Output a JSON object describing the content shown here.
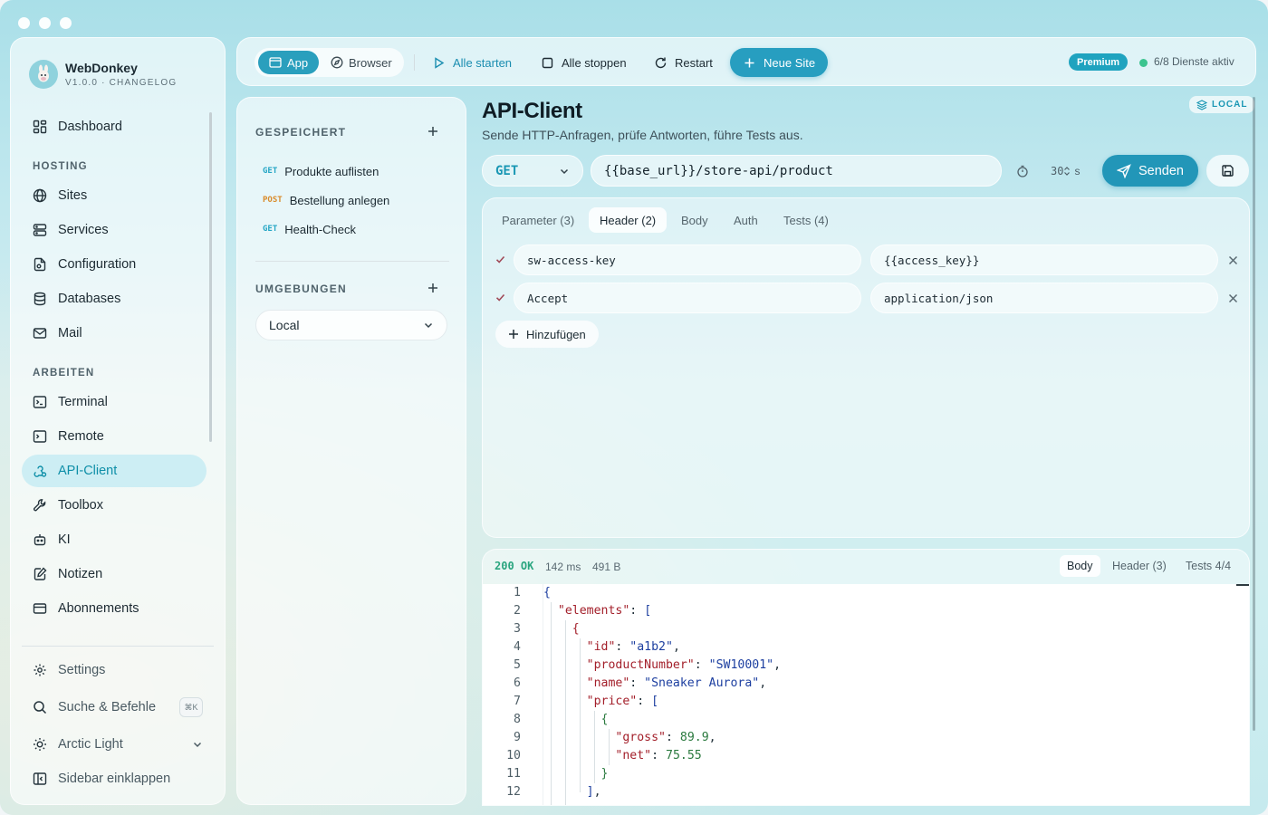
{
  "window": {
    "traffic_lights": 3
  },
  "brand": {
    "name": "WebDonkey",
    "version": "V1.0.0 · CHANGELOG"
  },
  "sidebar": {
    "dashboard": "Dashboard",
    "hosting_label": "HOSTING",
    "hosting": [
      {
        "label": "Sites",
        "icon": "globe-icon"
      },
      {
        "label": "Services",
        "icon": "server-icon"
      },
      {
        "label": "Configuration",
        "icon": "file-cog-icon"
      },
      {
        "label": "Databases",
        "icon": "database-icon"
      },
      {
        "label": "Mail",
        "icon": "mail-icon"
      }
    ],
    "work_label": "ARBEITEN",
    "work": [
      {
        "label": "Terminal",
        "icon": "terminal-icon"
      },
      {
        "label": "Remote",
        "icon": "remote-terminal-icon"
      },
      {
        "label": "API-Client",
        "icon": "webhook-icon",
        "active": true
      },
      {
        "label": "Toolbox",
        "icon": "wrench-icon"
      },
      {
        "label": "KI",
        "icon": "bot-icon"
      },
      {
        "label": "Notizen",
        "icon": "notebook-pen-icon"
      },
      {
        "label": "Abonnements",
        "icon": "credit-card-icon"
      }
    ],
    "settings": "Settings",
    "search": "Suche & Befehle",
    "search_shortcut": "⌘K",
    "theme": "Arctic Light",
    "collapse": "Sidebar einklappen"
  },
  "topbar": {
    "app": "App",
    "browser": "Browser",
    "start_all": "Alle starten",
    "stop_all": "Alle stoppen",
    "restart": "Restart",
    "new_site": "Neue Site",
    "premium": "Premium",
    "services_status": "6/8 Dienste aktiv"
  },
  "saved": {
    "label": "GESPEICHERT",
    "requests": [
      {
        "method": "GET",
        "name": "Produkte auflisten"
      },
      {
        "method": "POST",
        "name": "Bestellung anlegen"
      },
      {
        "method": "GET",
        "name": "Health-Check"
      }
    ],
    "env_label": "UMGEBUNGEN",
    "env_selected": "Local"
  },
  "main": {
    "title": "API-Client",
    "subtitle": "Sende HTTP-Anfragen, prüfe Antworten, führe Tests aus.",
    "badge": "LOCAL",
    "method": "GET",
    "url": "{{base_url}}/store-api/product",
    "timeout": "30",
    "timeout_unit": "s",
    "send": "Senden",
    "tabs": [
      "Parameter (3)",
      "Header (2)",
      "Body",
      "Auth",
      "Tests (4)"
    ],
    "active_tab": "Header (2)",
    "headers": [
      {
        "enabled": true,
        "key": "sw-access-key",
        "value": "{{access_key}}"
      },
      {
        "enabled": true,
        "key": "Accept",
        "value": "application/json"
      }
    ],
    "add": "Hinzufügen"
  },
  "response": {
    "status": "200 OK",
    "time": "142 ms",
    "size": "491 B",
    "tabs": [
      "Body",
      "Header (3)",
      "Tests 4/4"
    ],
    "active_tab": "Body",
    "lines": [
      "1",
      "2",
      "3",
      "4",
      "5",
      "6",
      "7",
      "8",
      "9",
      "10",
      "11",
      "12"
    ]
  },
  "colors": {
    "accent": "#2296b8",
    "success": "#2aa57f",
    "active_bg": "#cdeef4"
  }
}
